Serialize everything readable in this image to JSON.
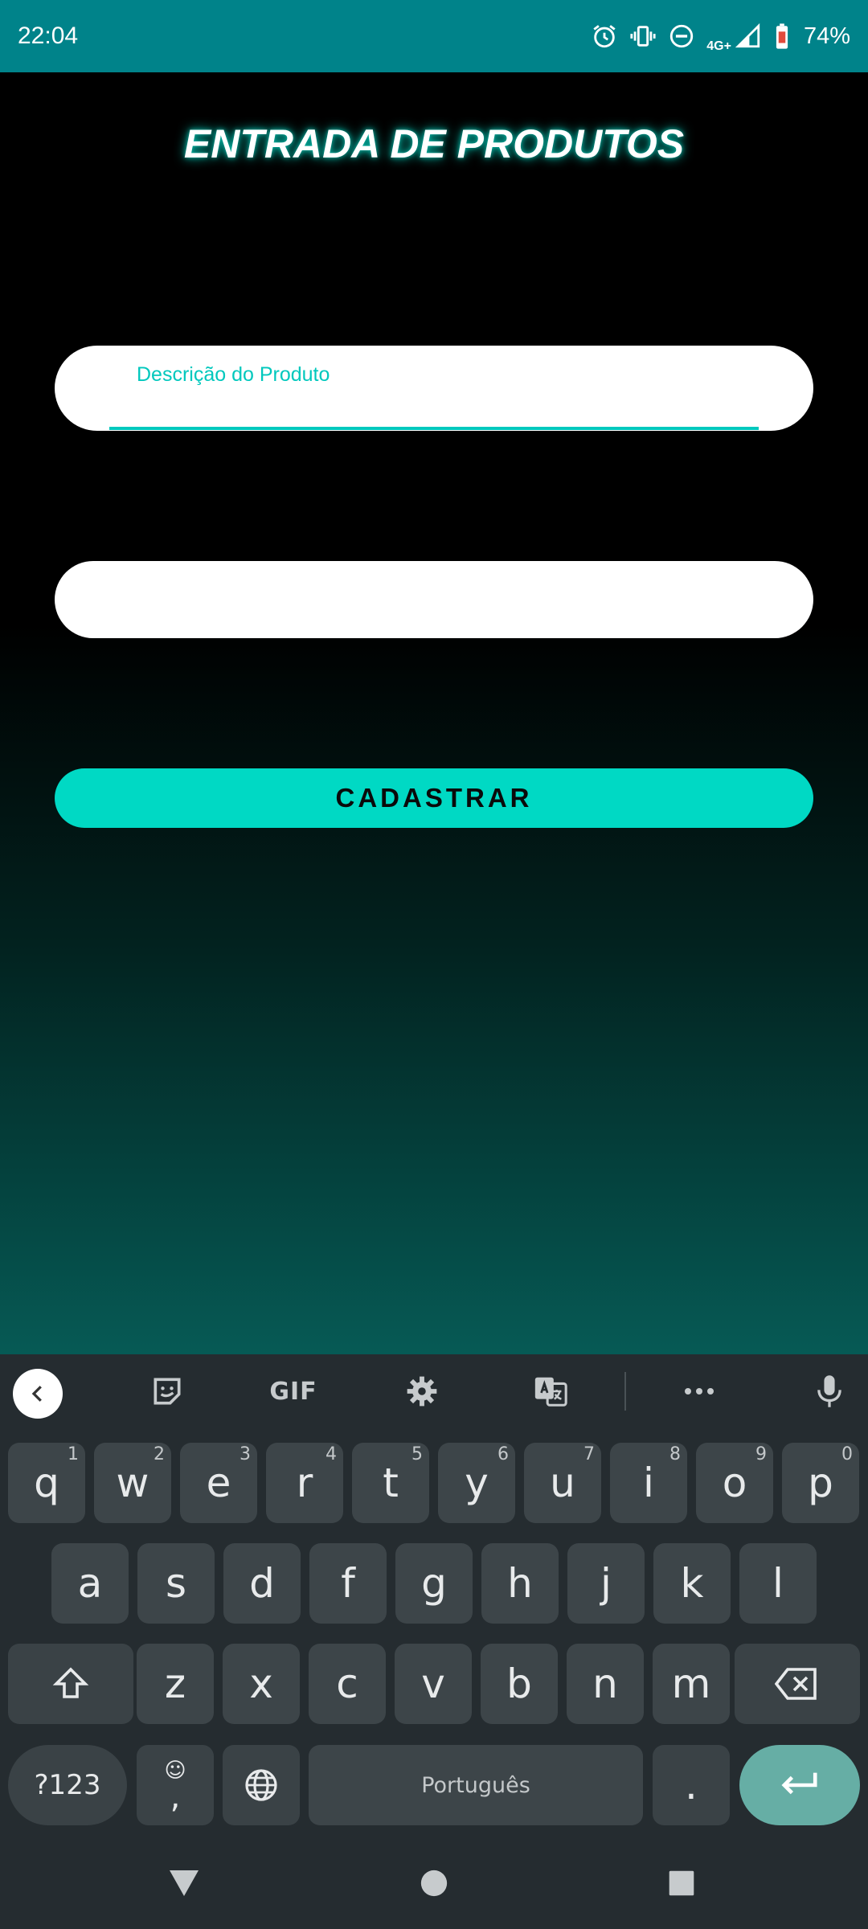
{
  "status_bar": {
    "time": "22:04",
    "network_label": "4G+",
    "battery_percent": "74%",
    "icons": [
      "alarm-icon",
      "vibrate-icon",
      "do-not-disturb-icon",
      "signal-icon",
      "battery-icon"
    ]
  },
  "app": {
    "title": "ENTRADA DE PRODUTOS",
    "description_field": {
      "label": "Descrição do Produto",
      "value": ""
    },
    "second_field": {
      "value": ""
    },
    "submit_label": "CADASTRAR",
    "colors": {
      "accent": "#00d9c4",
      "status_bar": "#00838a"
    }
  },
  "keyboard": {
    "toolbar": {
      "gif_label": "GIF"
    },
    "row1": [
      {
        "key": "q",
        "hint": "1"
      },
      {
        "key": "w",
        "hint": "2"
      },
      {
        "key": "e",
        "hint": "3"
      },
      {
        "key": "r",
        "hint": "4"
      },
      {
        "key": "t",
        "hint": "5"
      },
      {
        "key": "y",
        "hint": "6"
      },
      {
        "key": "u",
        "hint": "7"
      },
      {
        "key": "i",
        "hint": "8"
      },
      {
        "key": "o",
        "hint": "9"
      },
      {
        "key": "p",
        "hint": "0"
      }
    ],
    "row2": [
      "a",
      "s",
      "d",
      "f",
      "g",
      "h",
      "j",
      "k",
      "l"
    ],
    "row3": [
      "z",
      "x",
      "c",
      "v",
      "b",
      "n",
      "m"
    ],
    "symbols_label": "?123",
    "comma_label": ",",
    "comma_hint": "☺",
    "space_label": "Português",
    "period_label": "."
  }
}
